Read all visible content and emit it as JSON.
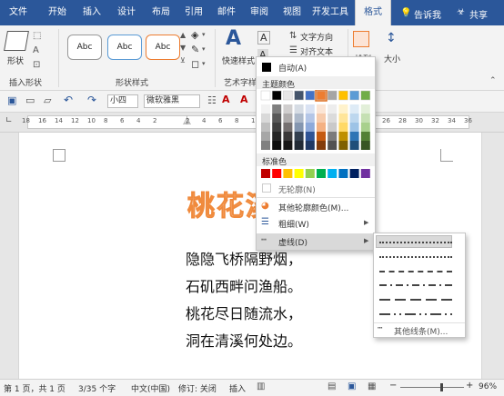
{
  "tabs": [
    "文件",
    "开始",
    "插入",
    "设计",
    "布局",
    "引用",
    "邮件",
    "审阅",
    "视图",
    "开发工具",
    "格式"
  ],
  "tell": "告诉我",
  "share": "共享",
  "ribbon": {
    "shape_label": "形状",
    "insert_shape_group": "插入形状",
    "style_sample": "Abc",
    "shape_styles_group": "形状样式",
    "quick_styles": "快速样式",
    "art_group": "艺术字样",
    "text_direction": "文字方向",
    "align_text": "对齐文本",
    "arrange": "排列",
    "size": "大小"
  },
  "qat": {
    "font_size": "小四",
    "font_name": "微软雅黑"
  },
  "ruler_marks": [
    "18",
    "16",
    "14",
    "12",
    "10",
    "8",
    "6",
    "4",
    "2",
    "",
    "2",
    "4",
    "6",
    "8",
    "10",
    "12",
    "14",
    "16",
    "18",
    "20",
    "22",
    "24",
    "26",
    "28",
    "30",
    "32",
    "34",
    "36"
  ],
  "document": {
    "title": "桃花溪",
    "lines": [
      "隐隐飞桥隔野烟，",
      "石矶西畔问渔船。",
      "桃花尽日随流水，",
      "洞在清溪何处边。"
    ]
  },
  "menu": {
    "auto": "自动(A)",
    "theme_colors": "主题颜色",
    "standard_colors": "标准色",
    "no_outline": "无轮廓(N)",
    "more_colors": "其他轮廓颜色(M)...",
    "weight": "粗细(W)",
    "dashes": "虚线(D)",
    "more_lines": "其他线条(M)..."
  },
  "theme_top": [
    "#ffffff",
    "#000000",
    "#e7e6e6",
    "#44546a",
    "#4472c4",
    "#ed7d31",
    "#a5a5a5",
    "#ffc000",
    "#5b9bd5",
    "#70ad47"
  ],
  "theme_cols": [
    [
      "#f2f2f2",
      "#d9d9d9",
      "#bfbfbf",
      "#a6a6a6",
      "#808080"
    ],
    [
      "#7f7f7f",
      "#595959",
      "#404040",
      "#262626",
      "#0d0d0d"
    ],
    [
      "#d0cece",
      "#aeabab",
      "#757070",
      "#3a3838",
      "#171616"
    ],
    [
      "#d6dce4",
      "#adb9ca",
      "#8496b0",
      "#323f4f",
      "#222a35"
    ],
    [
      "#d9e2f3",
      "#b4c6e7",
      "#8eaadb",
      "#2f5496",
      "#1f3864"
    ],
    [
      "#fbe5d5",
      "#f7cbac",
      "#f4b183",
      "#c55a11",
      "#833c0b"
    ],
    [
      "#ededed",
      "#dbdbdb",
      "#c9c9c9",
      "#7b7b7b",
      "#525252"
    ],
    [
      "#fff2cc",
      "#ffe599",
      "#ffd966",
      "#bf9000",
      "#7f6000"
    ],
    [
      "#deebf6",
      "#bdd7ee",
      "#9dc3e6",
      "#2e75b5",
      "#1f4e79"
    ],
    [
      "#e2efd9",
      "#c5e0b3",
      "#a8d08d",
      "#538135",
      "#375623"
    ]
  ],
  "standard": [
    "#c00000",
    "#ff0000",
    "#ffc000",
    "#ffff00",
    "#92d050",
    "#00b050",
    "#00b0f0",
    "#0070c0",
    "#002060",
    "#7030a0"
  ],
  "status": {
    "page": "第 1 页，共 1 页",
    "words": "3/35 个字",
    "lang": "中文(中国)",
    "revise": "修订: 关闭",
    "insert": "插入",
    "zoom": "96%"
  },
  "colors": {
    "accent": "#2b579a",
    "highlight": "#d9d9d9"
  }
}
